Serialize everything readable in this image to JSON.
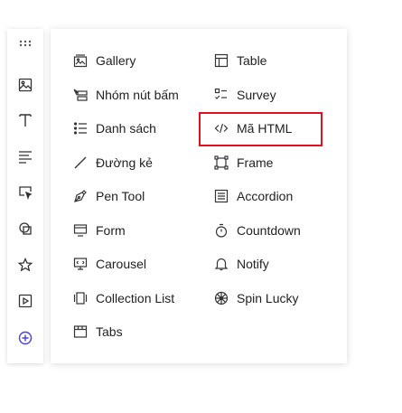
{
  "toolbar": {
    "items": [
      {
        "icon": "drag-handle-icon"
      },
      {
        "icon": "image-icon"
      },
      {
        "icon": "text-icon"
      },
      {
        "icon": "paragraph-icon"
      },
      {
        "icon": "button-icon"
      },
      {
        "icon": "shapes-icon"
      },
      {
        "icon": "star-icon"
      },
      {
        "icon": "video-icon"
      },
      {
        "icon": "add-circle-icon"
      }
    ],
    "active_color": "#4b3fe0"
  },
  "menu": {
    "left": [
      {
        "label": "Gallery",
        "icon": "gallery-icon"
      },
      {
        "label": "Nhóm nút bấm",
        "icon": "button-group-icon"
      },
      {
        "label": "Danh sách",
        "icon": "list-icon"
      },
      {
        "label": "Đường kẻ",
        "icon": "line-icon"
      },
      {
        "label": "Pen Tool",
        "icon": "pen-tool-icon"
      },
      {
        "label": "Form",
        "icon": "form-icon"
      },
      {
        "label": "Carousel",
        "icon": "carousel-icon"
      },
      {
        "label": "Collection List",
        "icon": "collection-list-icon"
      },
      {
        "label": "Tabs",
        "icon": "tabs-icon"
      }
    ],
    "right": [
      {
        "label": "Table",
        "icon": "table-icon"
      },
      {
        "label": "Survey",
        "icon": "survey-icon"
      },
      {
        "label": "Mã HTML",
        "icon": "code-icon"
      },
      {
        "label": "Frame",
        "icon": "frame-icon"
      },
      {
        "label": "Accordion",
        "icon": "accordion-icon"
      },
      {
        "label": "Countdown",
        "icon": "countdown-icon"
      },
      {
        "label": "Notify",
        "icon": "bell-icon"
      },
      {
        "label": "Spin Lucky",
        "icon": "spin-wheel-icon"
      }
    ],
    "highlight_color": "#e0121f"
  }
}
